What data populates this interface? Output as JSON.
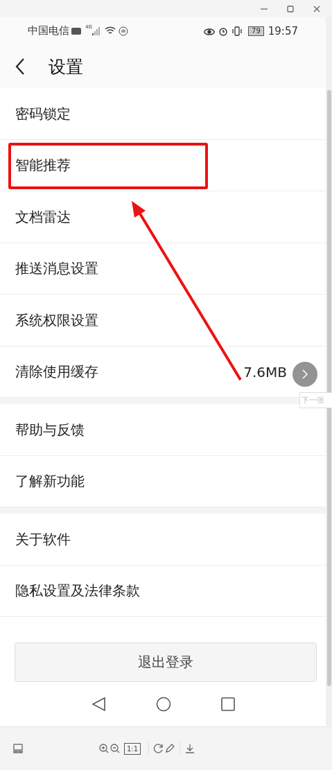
{
  "status_bar": {
    "carrier": "中国电信",
    "network": "4G",
    "battery": "79",
    "time": "19:57"
  },
  "header": {
    "title": "设置"
  },
  "sections": [
    {
      "items": [
        {
          "label": "密码锁定"
        },
        {
          "label": "智能推荐",
          "highlighted": true
        },
        {
          "label": "文档雷达"
        },
        {
          "label": "推送消息设置"
        },
        {
          "label": "系统权限设置"
        },
        {
          "label": "清除使用缓存",
          "value": "7.6MB"
        }
      ]
    },
    {
      "items": [
        {
          "label": "帮助与反馈"
        },
        {
          "label": "了解新功能"
        }
      ]
    },
    {
      "items": [
        {
          "label": "关于软件"
        },
        {
          "label": "隐私设置及法律条款"
        }
      ]
    }
  ],
  "logout_button": "退出登录",
  "viewer": {
    "next_tooltip": "下一张",
    "zoom_reset": "1:1"
  }
}
